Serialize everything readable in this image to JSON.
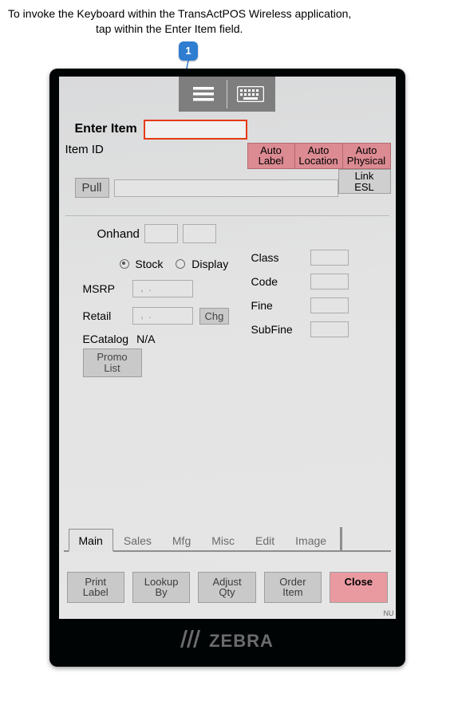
{
  "instruction": {
    "line1": "To  invoke the Keyboard within the TransActPOS Wireless application,",
    "line2": "tap within the Enter Item field."
  },
  "callout": {
    "number": "1"
  },
  "topbar": {
    "menu_icon": "menu-icon",
    "keyboard_icon": "keyboard-icon"
  },
  "fields": {
    "enter_item_label": "Enter Item",
    "enter_item_value": "",
    "item_id_label": "Item ID",
    "auto_buttons": [
      {
        "line1": "Auto",
        "line2": "Label"
      },
      {
        "line1": "Auto",
        "line2": "Location"
      },
      {
        "line1": "Auto",
        "line2": "Physical"
      }
    ],
    "link_esl": {
      "line1": "Link",
      "line2": "ESL"
    },
    "pull_label": "Pull",
    "onhand_label": "Onhand",
    "stock_label": "Stock",
    "display_label": "Display",
    "msrp_label": "MSRP",
    "msrp_value": ", .",
    "retail_label": "Retail",
    "retail_value": ", .",
    "chg_label": "Chg",
    "ecatalog_label": "ECatalog",
    "ecatalog_value": "N/A",
    "promo_list": {
      "line1": "Promo",
      "line2": "List"
    },
    "class_label": "Class",
    "code_label": "Code",
    "fine_label": "Fine",
    "subfine_label": "SubFine"
  },
  "tabs": [
    "Main",
    "Sales",
    "Mfg",
    "Misc",
    "Edit",
    "Image"
  ],
  "active_tab_index": 0,
  "bottom_buttons": [
    {
      "line1": "Print",
      "line2": "Label"
    },
    {
      "line1": "Lookup",
      "line2": "By"
    },
    {
      "line1": "Adjust",
      "line2": "Qty"
    },
    {
      "line1": "Order",
      "line2": "Item"
    },
    {
      "line1": "Close",
      "line2": ""
    }
  ],
  "corner_text": "NU",
  "brand": "ZEBRA"
}
